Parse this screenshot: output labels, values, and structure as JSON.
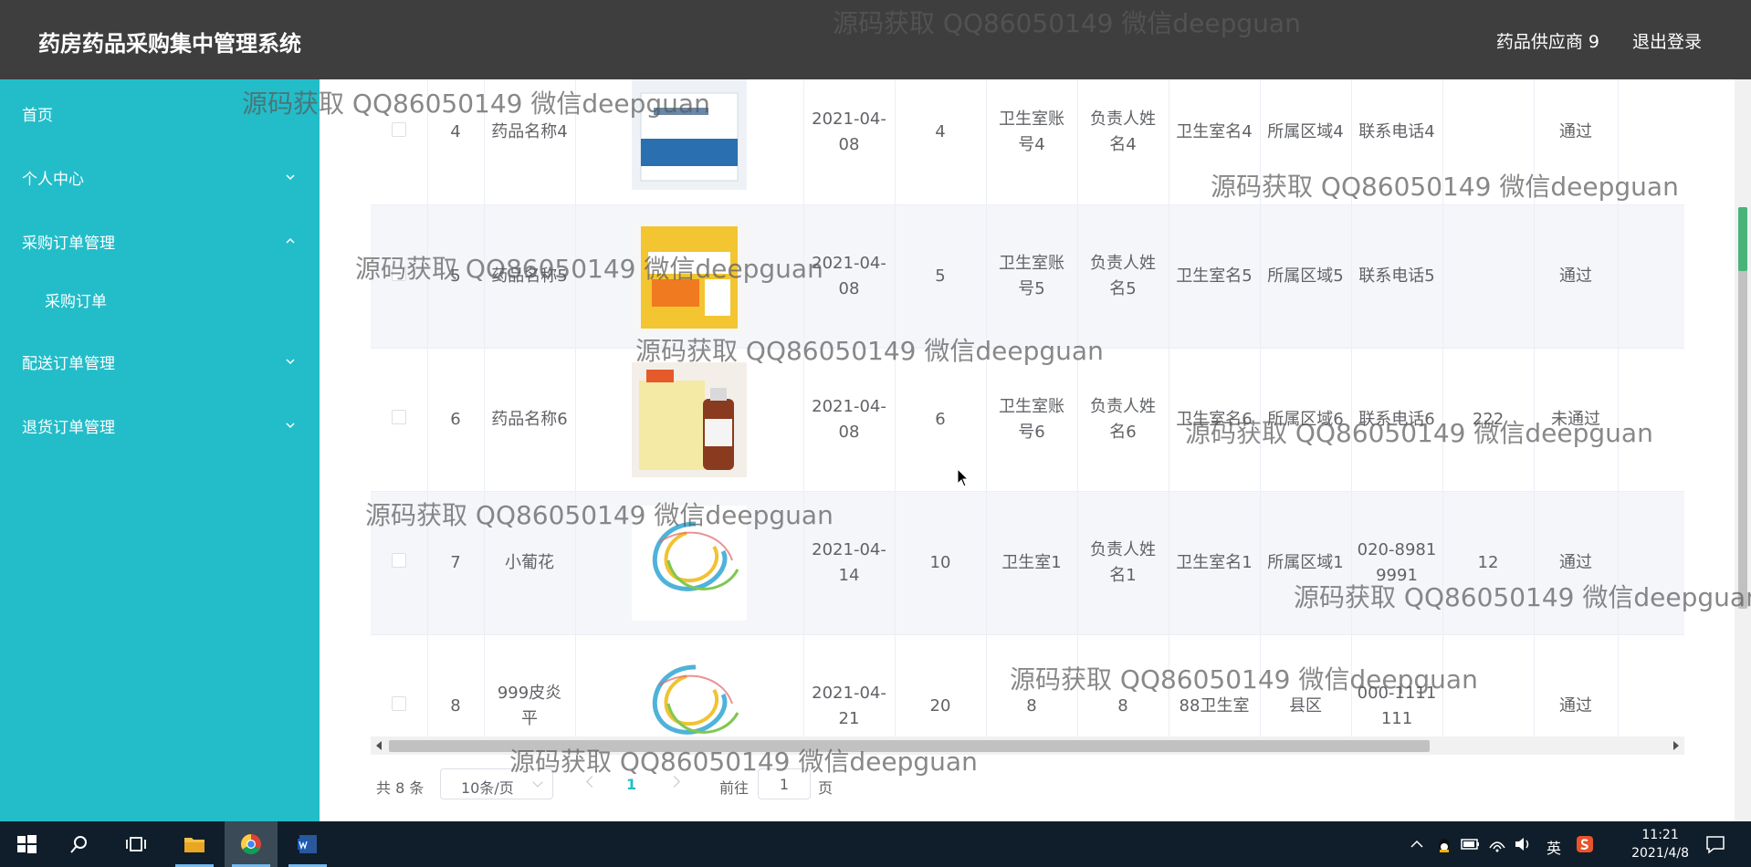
{
  "header": {
    "title": "药房药品采购集中管理系统",
    "user": "药品供应商 9",
    "logout": "退出登录"
  },
  "sidebar": {
    "items": [
      {
        "label": "首页",
        "has_chevron": false
      },
      {
        "label": "个人中心",
        "has_chevron": true,
        "chevron": "down"
      },
      {
        "label": "采购订单管理",
        "has_chevron": true,
        "chevron": "up"
      },
      {
        "label": "采购订单",
        "sub": true
      },
      {
        "label": "配送订单管理",
        "has_chevron": true,
        "chevron": "down"
      },
      {
        "label": "退货订单管理",
        "has_chevron": true,
        "chevron": "down"
      }
    ]
  },
  "table": {
    "rows": [
      {
        "index": "4",
        "name": "药品名称4",
        "date": "2021-04-08",
        "qty": "4",
        "clinic_account": "卫生室账号4",
        "manager": "负责人姓名4",
        "clinic_name": "卫生室名4",
        "region": "所属区域4",
        "phone": "联系电话4",
        "reply": "",
        "status": "通过",
        "image": "box-blue"
      },
      {
        "index": "5",
        "name": "药品名称5",
        "date": "2021-04-08",
        "qty": "5",
        "clinic_account": "卫生室账号5",
        "manager": "负责人姓名5",
        "clinic_name": "卫生室名5",
        "region": "所属区域5",
        "phone": "联系电话5",
        "reply": "",
        "status": "通过",
        "image": "box-yellow"
      },
      {
        "index": "6",
        "name": "药品名称6",
        "date": "2021-04-08",
        "qty": "6",
        "clinic_account": "卫生室账号6",
        "manager": "负责人姓名6",
        "clinic_name": "卫生室名6",
        "region": "所属区域6",
        "phone": "联系电话6",
        "reply": "222",
        "status": "未通过",
        "image": "bottle"
      },
      {
        "index": "7",
        "name": "小葡花",
        "date": "2021-04-14",
        "qty": "10",
        "clinic_account": "卫生室1",
        "manager": "负责人姓名1",
        "clinic_name": "卫生室名1",
        "region": "所属区域1",
        "phone": "020-89819991",
        "reply": "12",
        "status": "通过",
        "image": "swirl"
      },
      {
        "index": "8",
        "name": "999皮炎平",
        "date": "2021-04-21",
        "qty": "20",
        "clinic_account": "8",
        "manager": "8",
        "clinic_name": "88卫生室",
        "region": "县区",
        "phone": "000-1111111",
        "reply": "",
        "status": "通过",
        "image": "swirl"
      }
    ]
  },
  "pagination": {
    "total": "共 8 条",
    "page_size": "10条/页",
    "current": "1",
    "goto_label": "前往",
    "goto_value": "1",
    "goto_unit": "页"
  },
  "watermark": "源码获取 QQ86050149 微信deepguan",
  "taskbar": {
    "ime": "英",
    "time": "11:21",
    "date": "2021/4/8"
  },
  "colors": {
    "sidebar": "#22bdc9",
    "header": "#3e3e3e",
    "accent": "#22bdc9"
  }
}
